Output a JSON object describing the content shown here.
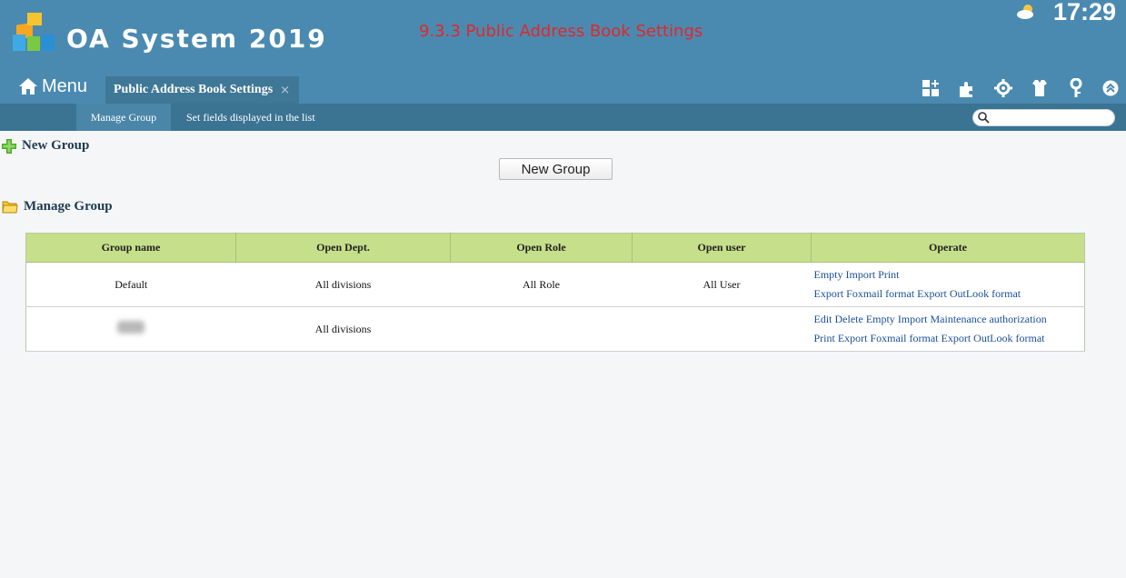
{
  "header": {
    "app_title": "OA System 2019",
    "caption": "9.3.3 Public Address Book Settings",
    "clock": "17:29"
  },
  "nav": {
    "menu_label": "Menu",
    "tab_label": "Public Address Book Settings",
    "tab_close": "×"
  },
  "subnav": {
    "items": [
      "Manage Group",
      "Set fields displayed in the list"
    ],
    "search_placeholder": ""
  },
  "sections": {
    "new_group_heading": "New Group",
    "new_group_button": "New Group",
    "manage_group_heading": "Manage Group"
  },
  "table": {
    "headers": [
      "Group name",
      "Open Dept.",
      "Open Role",
      "Open user",
      "Operate"
    ],
    "rows": [
      {
        "group_name": "Default",
        "open_dept": "All divisions",
        "open_role": "All Role",
        "open_user": "All User",
        "ops_line1": [
          "Empty",
          "Import",
          "Print"
        ],
        "ops_line2": [
          "Export Foxmail format",
          "Export OutLook format"
        ]
      },
      {
        "group_name": "",
        "open_dept": "All divisions",
        "open_role": "",
        "open_user": "",
        "ops_line1": [
          "Edit",
          "Delete",
          "Empty",
          "Import",
          "Maintenance authorization"
        ],
        "ops_line2": [
          "Print",
          "Export Foxmail format",
          "Export OutLook format"
        ]
      }
    ]
  },
  "colors": {
    "header_bg": "#4b8ab0",
    "subnav_bg": "#3b7393",
    "table_header_bg": "#c6df8a",
    "link": "#1b4f9a",
    "caption": "#e0282a"
  }
}
